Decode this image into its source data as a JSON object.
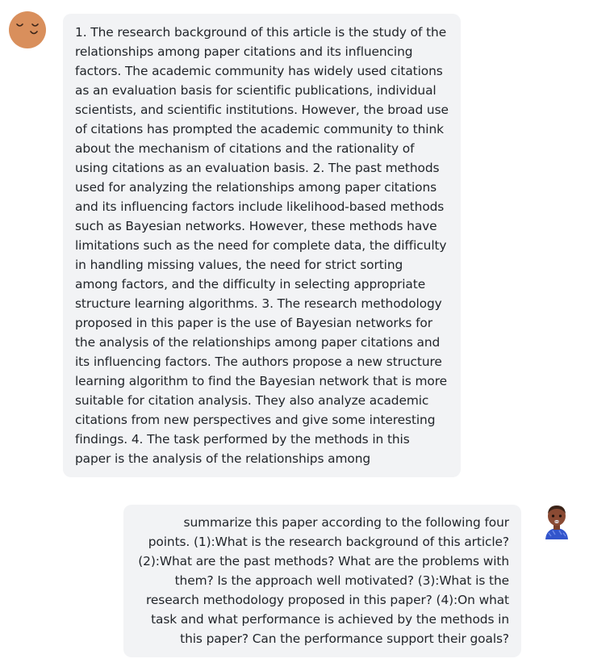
{
  "conversation": {
    "messages": [
      {
        "role": "assistant",
        "avatar_icon": "smiling-face-icon",
        "text": "1. The research background of this article is the study of the\nrelationships among paper citations and its influencing\nfactors. The academic community has widely used citations\nas an evaluation basis for scientific publications, individual\nscientists, and scientific institutions. However, the broad use\nof citations has prompted the academic community to think\nabout the mechanism of citations and the rationality of\nusing citations as an evaluation basis. 2. The past methods\nused for analyzing the relationships among paper citations\nand its influencing factors include likelihood-based methods\nsuch as Bayesian networks. However, these methods have\nlimitations such as the need for complete data, the difficulty\nin handling missing values, the need for strict sorting\namong factors, and the difficulty in selecting appropriate\nstructure learning algorithms. 3. The research methodology\nproposed in this paper is the use of Bayesian networks for\nthe analysis of the relationships among paper citations and\nits influencing factors. The authors propose a new structure\nlearning algorithm to find the Bayesian network that is more\nsuitable for citation analysis. They also analyze academic\ncitations from new perspectives and give some interesting\nfindings. 4. The task performed by the methods in this\npaper is the analysis of the relationships among"
      },
      {
        "role": "user",
        "avatar_icon": "user-avatar-icon",
        "text": "summarize this paper according to the following four\npoints. (1):What is the research background of this article?\n(2):What are the past methods? What are the problems with\nthem? Is the approach well motivated? (3):What is the\nresearch methodology proposed in this paper? (4):On what\ntask and what performance is achieved by the methods in\nthis paper? Can the performance support their goals?"
      }
    ]
  },
  "colors": {
    "bubble_background": "#f2f3f5",
    "text": "#1f2328",
    "bot_avatar": "#d98f5c",
    "user_avatar_skin": "#8a4a33",
    "user_avatar_shirt": "#3355cc"
  }
}
